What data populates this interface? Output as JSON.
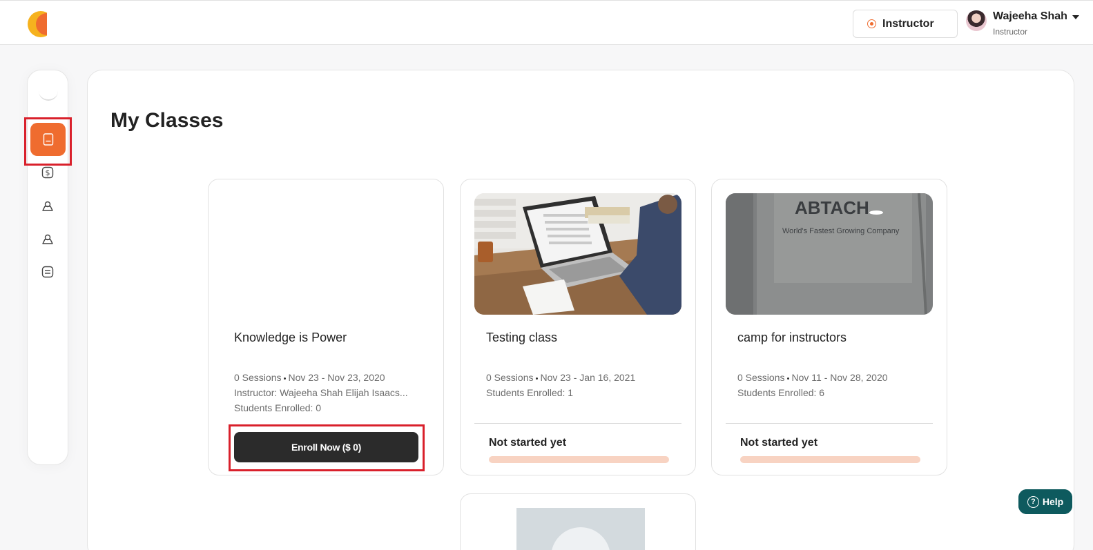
{
  "header": {
    "role_button": "Instructor",
    "user": {
      "name": "Wajeeha Shah",
      "role": "Instructor"
    }
  },
  "sidebar": {
    "items": [
      {
        "icon": "book-icon",
        "active": true
      },
      {
        "icon": "dollar-icon",
        "active": false
      },
      {
        "icon": "user-icon",
        "active": false
      },
      {
        "icon": "user-icon",
        "active": false
      },
      {
        "icon": "list-icon",
        "active": false
      }
    ]
  },
  "main": {
    "title": "My Classes",
    "classes": [
      {
        "title": "Knowledge is Power",
        "sessions": "0 Sessions",
        "dates": "Nov 23 - Nov 23, 2020",
        "instructor": "Instructor: Wajeeha Shah  Elijah Isaacs...",
        "students": "Students Enrolled: 0",
        "button": "Enroll Now ($ 0)"
      },
      {
        "title": "Testing class",
        "sessions": "0 Sessions",
        "dates": "Nov 23 - Jan 16, 2021",
        "students": "Students Enrolled: 1",
        "status": "Not started yet",
        "progress": 0
      },
      {
        "title": "camp for instructors",
        "sessions": "0 Sessions",
        "dates": "Nov 11 - Nov 28, 2020",
        "students": "Students Enrolled: 6",
        "status": "Not started yet",
        "progress": 0,
        "image_text": {
          "headline": "ABTACH",
          "tagline": "World's Fastest Growing Company"
        }
      }
    ]
  },
  "help": {
    "label": "Help"
  },
  "colors": {
    "accent": "#ef6c2f",
    "progress_track": "#f8d3c2",
    "help_bg": "#0e5a5e",
    "annotation": "#d9202b"
  }
}
